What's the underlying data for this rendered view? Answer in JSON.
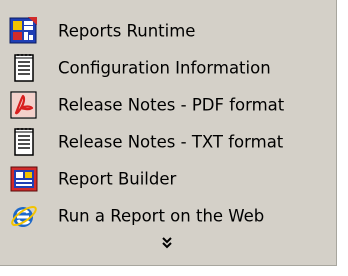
{
  "menu": {
    "items": [
      {
        "label": "Reports Runtime",
        "icon": "reports-runtime-icon"
      },
      {
        "label": "Configuration Information",
        "icon": "text-document-icon"
      },
      {
        "label": "Release Notes - PDF format",
        "icon": "pdf-document-icon"
      },
      {
        "label": "Release Notes - TXT format",
        "icon": "text-document-icon"
      },
      {
        "label": "Report Builder",
        "icon": "report-builder-icon"
      },
      {
        "label": "Run a Report on the Web",
        "icon": "internet-explorer-icon"
      }
    ],
    "more": {
      "icon": "double-chevron-down-icon"
    }
  },
  "colors": {
    "menu_background": "#d4d0c8",
    "text": "#000000",
    "report_blue": "#1f3fb5",
    "report_red": "#d12b2b",
    "report_yellow": "#f2c300",
    "pdf_red": "#d81f1f",
    "ie_blue": "#1d68c9"
  }
}
